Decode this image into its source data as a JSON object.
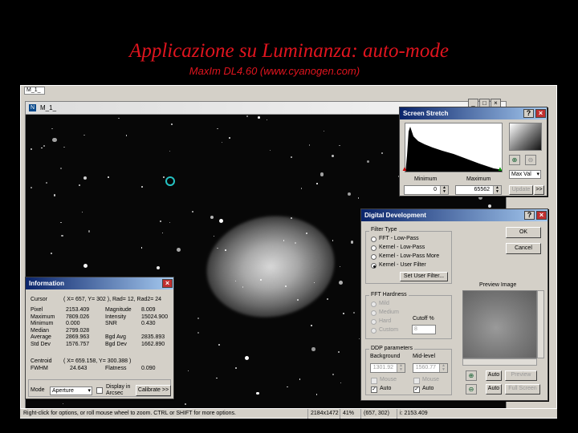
{
  "slide": {
    "title": "Applicazione  su Luminanza: auto-mode",
    "subtitle": "MaxIm DL4.60 (www.cyanogen.com)"
  },
  "app": {
    "doc_tab": "M_1_",
    "image_window_title": "M_1_"
  },
  "screen_stretch": {
    "title": "Screen Stretch",
    "minimum_label": "Minimum",
    "maximum_label": "Maximum",
    "minimum_value": "0",
    "maximum_value": "65562",
    "mode": "Max Val",
    "update_label": "Update",
    "more_label": ">>"
  },
  "digital_development": {
    "title": "Digital Development",
    "filter_type_label": "Filter Type",
    "filters": [
      "FFT - Low-Pass",
      "Kernel - Low-Pass",
      "Kernel - Low-Pass More",
      "Kernel - User Filter"
    ],
    "selected_filter": 3,
    "set_user_filter_label": "Set User Filter...",
    "ok_label": "OK",
    "cancel_label": "Cancel",
    "fft_hardness_label": "FFT Hardness",
    "hardness_options": [
      "Mild",
      "Medium",
      "Hard",
      "Custom"
    ],
    "cutoff_label": "Cutoff %",
    "cutoff_value": "8",
    "ddp_label": "DDP parameters",
    "background_label": "Background",
    "midlevel_label": "Mid-level",
    "background_value": "1301.92",
    "midlevel_value": "1560.77",
    "mouse_label": "Mouse",
    "auto_label": "Auto",
    "preview_image_label": "Preview Image",
    "preview_btn": "Preview",
    "full_screen_btn": "Full Screen",
    "zoom_auto_1": "Auto",
    "zoom_auto_2": "Auto"
  },
  "information": {
    "title": "Information",
    "cursor_label": "Cursor",
    "cursor_value": "( X= 657, Y= 302 ), Rad= 12, Rad2= 24",
    "left_labels": [
      "Pixel",
      "Maximum",
      "Minimum",
      "Median",
      "Average",
      "Std Dev"
    ],
    "left_values": [
      "2153.409",
      "7809.026",
      "0.000",
      "2799.028",
      "2869.963",
      "1576.757"
    ],
    "right_labels": [
      "Magnitude",
      "Intensity",
      "SNR",
      "",
      "Bgd Avg",
      "Bgd Dev"
    ],
    "right_values": [
      "8.009",
      "15024.900",
      "0.430",
      "",
      "2835.893",
      "1662.890"
    ],
    "centroid_label": "Centroid",
    "centroid_value": "( X= 659.158, Y= 300.388 )",
    "fwhm_label": "FWHM",
    "fwhm_value": "24.643",
    "flatness_label": "Flatness",
    "flatness_value": "0.090",
    "mode_label": "Mode",
    "mode_value": "Aperture",
    "display_label_1": "Display in",
    "display_label_2": "Arcsec",
    "calibrate_label": "Calibrate >>"
  },
  "status_bar": {
    "hint": "Right-click for options, or roll mouse wheel to zoom. CTRL or SHIFT for more options.",
    "dimensions": "2184x1472",
    "zoom": "41%",
    "coords": "(657, 302)",
    "intensity": "i: 2153.409"
  }
}
